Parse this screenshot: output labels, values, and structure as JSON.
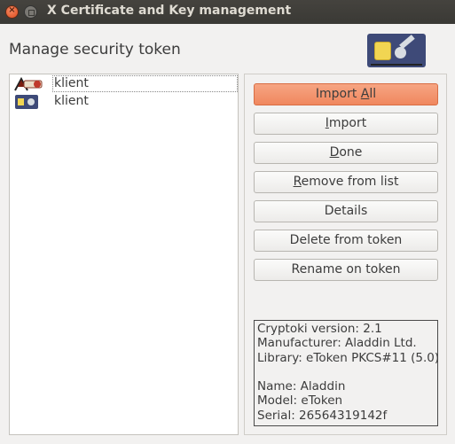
{
  "window": {
    "title": "X Certificate and Key management",
    "close_label": "×"
  },
  "heading": "Manage security token",
  "list": {
    "items": [
      {
        "icon": "certificate-icon",
        "label": "klient",
        "selected": true
      },
      {
        "icon": "smartcard-key-icon",
        "label": "klient",
        "selected": false
      }
    ]
  },
  "buttons": [
    {
      "pre": "Import ",
      "mn": "A",
      "post": "ll",
      "default": true
    },
    {
      "pre": "",
      "mn": "I",
      "post": "mport",
      "default": false
    },
    {
      "pre": "",
      "mn": "D",
      "post": "one",
      "default": false
    },
    {
      "pre": "",
      "mn": "R",
      "post": "emove from list",
      "default": false
    },
    {
      "pre": "Details",
      "mn": "",
      "post": "",
      "default": false
    },
    {
      "pre": "Delete from token",
      "mn": "",
      "post": "",
      "default": false
    },
    {
      "pre": "Rename on token",
      "mn": "",
      "post": "",
      "default": false
    }
  ],
  "token_info": {
    "cryptoki_version": "Cryptoki version: 2.1",
    "manufacturer": "Manufacturer: Aladdin Ltd.",
    "library": "Library: eToken PKCS#11 (5.0)",
    "blank": "",
    "name": "Name: Aladdin",
    "model": "Model: eToken",
    "serial": "Serial: 26564319142f"
  },
  "colors": {
    "accent": "#f0875e",
    "titlebar": "#3c3b37"
  }
}
